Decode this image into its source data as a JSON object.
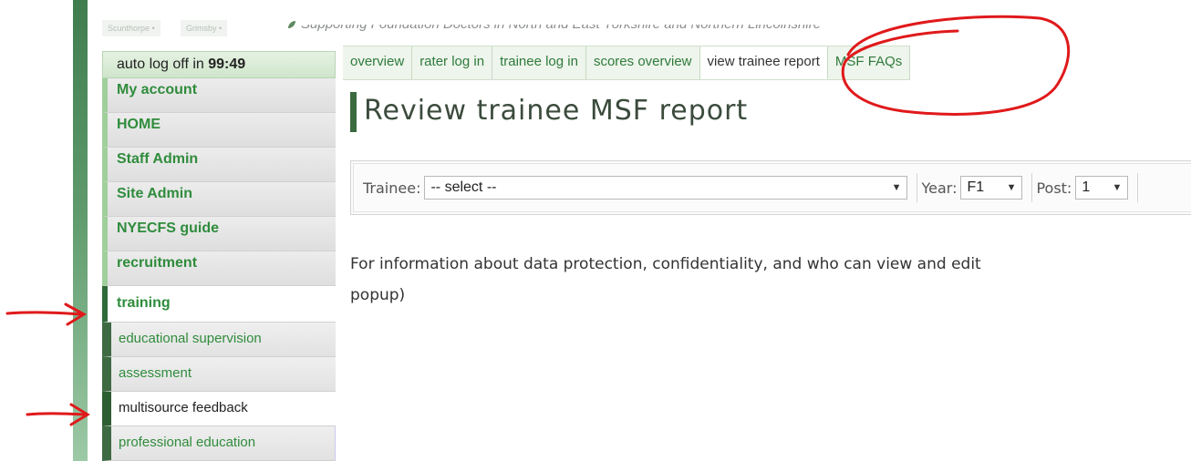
{
  "header": {
    "town_tabs": [
      "Scunthorpe •",
      "Grimsby •"
    ],
    "tagline": "Supporting Foundation Doctors in North and East Yorkshire and Northern Lincolnshire"
  },
  "session": {
    "autolog_label": "auto log off in",
    "autolog_time": "99:49"
  },
  "tabs": [
    {
      "label": "overview"
    },
    {
      "label": "rater log in"
    },
    {
      "label": "trainee log in"
    },
    {
      "label": "scores overview"
    },
    {
      "label": "view trainee report"
    },
    {
      "label": "MSF FAQs"
    }
  ],
  "sidebar": {
    "items": [
      {
        "label": "My account"
      },
      {
        "label": "HOME"
      },
      {
        "label": "Staff Admin"
      },
      {
        "label": "Site Admin"
      },
      {
        "label": "NYECFS guide"
      },
      {
        "label": "recruitment"
      },
      {
        "label": "training"
      }
    ],
    "subitems": [
      {
        "label": "educational supervision"
      },
      {
        "label": "assessment"
      },
      {
        "label": "multisource feedback"
      },
      {
        "label": "professional education"
      }
    ]
  },
  "main": {
    "title": "Review trainee MSF report",
    "filters": {
      "trainee_label": "Trainee:",
      "trainee_value": "-- select --",
      "year_label": "Year:",
      "year_value": "F1",
      "post_label": "Post:",
      "post_value": "1"
    },
    "info_line1": "For information about data protection, confidentiality, and who can view and edit",
    "info_line2": "popup)"
  },
  "colors": {
    "accent_green": "#2f8c3c",
    "dark_green": "#3a6a3e",
    "annotation_red": "#e0191b"
  }
}
